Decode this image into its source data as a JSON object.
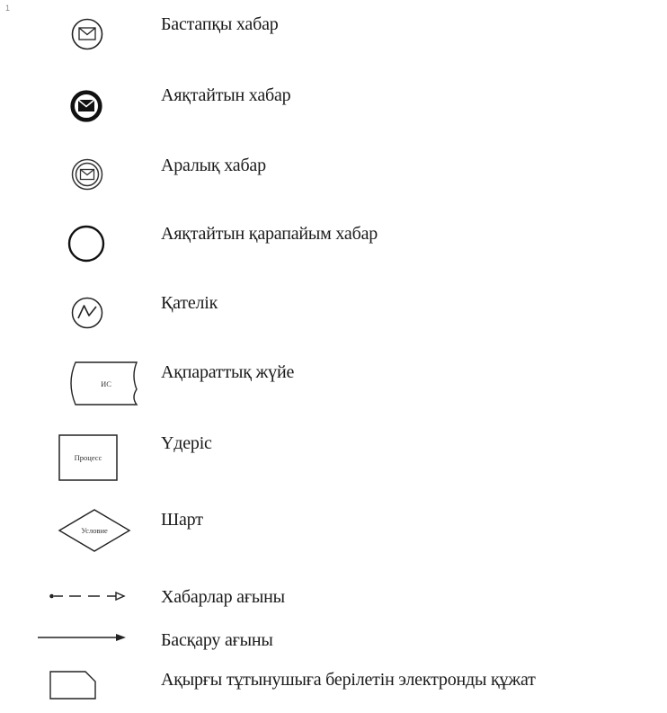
{
  "corner_mark": "1",
  "legend": {
    "items": [
      {
        "icon": "start-message-icon",
        "label": "Бастапқы хабар"
      },
      {
        "icon": "end-message-icon",
        "label": "Аяқтайтын хабар"
      },
      {
        "icon": "intermediate-message-icon",
        "label": "Аралық хабар"
      },
      {
        "icon": "end-simple-event-icon",
        "label": "Аяқтайтын қарапайым хабар"
      },
      {
        "icon": "error-icon",
        "label": "Қателік"
      },
      {
        "icon": "information-system-icon",
        "label": "Ақпараттық жүйе",
        "inner_text": "ИС"
      },
      {
        "icon": "process-icon",
        "label": "Үдеріс",
        "inner_text": "Процесс"
      },
      {
        "icon": "condition-icon",
        "label": "Шарт",
        "inner_text": "Условие"
      },
      {
        "icon": "message-flow-icon",
        "label": "Хабарлар ағыны"
      },
      {
        "icon": "control-flow-icon",
        "label": "Басқару ағыны"
      },
      {
        "icon": "electronic-document-icon",
        "label": "Ақырғы тұтынушыға берілетін электронды құжат"
      }
    ]
  }
}
